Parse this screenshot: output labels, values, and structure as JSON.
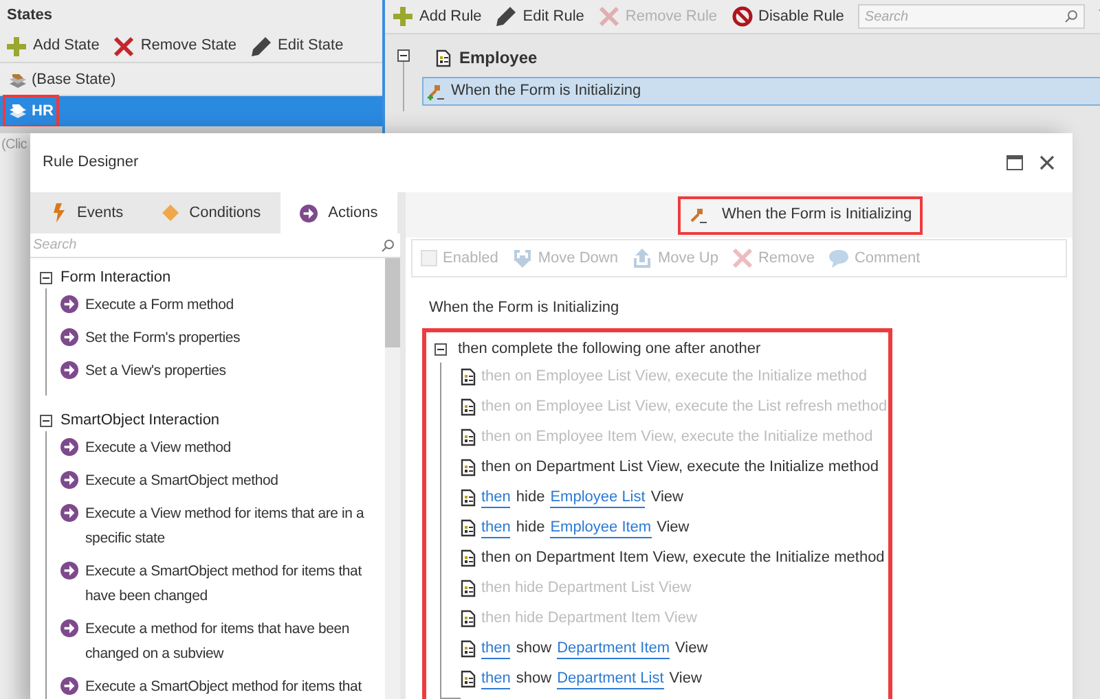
{
  "states_panel": {
    "title": "States",
    "toolbar": [
      {
        "label": "Add State",
        "kind": "plus"
      },
      {
        "label": "Remove State",
        "kind": "remove"
      },
      {
        "label": "Edit State",
        "kind": "edit"
      }
    ],
    "items": [
      {
        "label": "(Base State)",
        "selected": false,
        "highlighted": false
      },
      {
        "label": "HR",
        "selected": true,
        "highlighted": true
      }
    ],
    "hint": "(Clic"
  },
  "rules_panel": {
    "toolbar": [
      {
        "label": "Add Rule",
        "kind": "plus",
        "disabled": false
      },
      {
        "label": "Edit Rule",
        "kind": "edit",
        "disabled": false
      },
      {
        "label": "Remove Rule",
        "kind": "remove",
        "disabled": true
      },
      {
        "label": "Disable Rule",
        "kind": "block",
        "disabled": false
      }
    ],
    "search": {
      "placeholder": "Search"
    },
    "tree": {
      "label": "Employee",
      "expanded": true,
      "children": [
        {
          "label": "When the Form is Initializing",
          "selected": true
        }
      ]
    }
  },
  "dialog": {
    "title": "Rule Designer",
    "tabs": [
      {
        "label": "Events",
        "kind": "events",
        "selected": false
      },
      {
        "label": "Conditions",
        "kind": "conditions",
        "selected": false
      },
      {
        "label": "Actions",
        "kind": "actions",
        "selected": true
      }
    ],
    "search": {
      "placeholder": "Search"
    },
    "groups": [
      {
        "label": "Form Interaction",
        "expanded": true,
        "children": [
          {
            "label": "Execute a Form method"
          },
          {
            "label": "Set the Form's properties"
          },
          {
            "label": "Set a View's properties"
          }
        ]
      },
      {
        "label": "SmartObject Interaction",
        "expanded": true,
        "children": [
          {
            "label": "Execute a View method"
          },
          {
            "label": "Execute a SmartObject method"
          },
          {
            "label": "Execute a View method for items that are in a specific state"
          },
          {
            "label": "Execute a SmartObject method for items that have been changed"
          },
          {
            "label": "Execute a method for items that have been changed on a subview"
          },
          {
            "label": "Execute a SmartObject method for items that"
          }
        ]
      }
    ],
    "rule_heading": {
      "text": "When the Form is Initializing",
      "highlighted": true
    },
    "toolbar": [
      {
        "label": "Enabled",
        "kind": "checkbox",
        "checked": false,
        "disabled": true
      },
      {
        "label": "Move Down",
        "kind": "down",
        "disabled": true
      },
      {
        "label": "Move Up",
        "kind": "up",
        "disabled": true
      },
      {
        "label": "Remove",
        "kind": "remove",
        "disabled": true
      },
      {
        "label": "Comment",
        "kind": "comment",
        "disabled": true
      }
    ],
    "event_text": "When the Form is Initializing",
    "action_group": {
      "label": "then complete the following one after another",
      "expanded": true,
      "highlighted": true,
      "children": [
        {
          "disabled": true,
          "segments": [
            {
              "text": "then on Employee List View, execute the Initialize method",
              "link": false
            }
          ]
        },
        {
          "disabled": true,
          "segments": [
            {
              "text": "then on Employee List View, execute the List refresh method",
              "link": false
            }
          ]
        },
        {
          "disabled": true,
          "segments": [
            {
              "text": "then on Employee Item View, execute the Initialize method",
              "link": false
            }
          ]
        },
        {
          "disabled": false,
          "segments": [
            {
              "text": "then on Department List View, execute the Initialize method",
              "link": false
            }
          ]
        },
        {
          "disabled": false,
          "segments": [
            {
              "text": "then",
              "link": true
            },
            {
              "text": "hide",
              "link": false
            },
            {
              "text": "Employee List",
              "link": true
            },
            {
              "text": "View",
              "link": false
            }
          ]
        },
        {
          "disabled": false,
          "segments": [
            {
              "text": "then",
              "link": true
            },
            {
              "text": "hide",
              "link": false
            },
            {
              "text": "Employee Item",
              "link": true
            },
            {
              "text": "View",
              "link": false
            }
          ]
        },
        {
          "disabled": false,
          "segments": [
            {
              "text": "then on Department Item View, execute the Initialize method",
              "link": false
            }
          ]
        },
        {
          "disabled": true,
          "segments": [
            {
              "text": "then hide Department List View",
              "link": false
            }
          ]
        },
        {
          "disabled": true,
          "segments": [
            {
              "text": "then hide Department Item View",
              "link": false
            }
          ]
        },
        {
          "disabled": false,
          "segments": [
            {
              "text": "then",
              "link": true
            },
            {
              "text": "show",
              "link": false
            },
            {
              "text": "Department Item",
              "link": true
            },
            {
              "text": "View",
              "link": false
            }
          ]
        },
        {
          "disabled": false,
          "segments": [
            {
              "text": "then",
              "link": true
            },
            {
              "text": "show",
              "link": false
            },
            {
              "text": "Department List",
              "link": true
            },
            {
              "text": "View",
              "link": false
            }
          ]
        }
      ]
    }
  }
}
